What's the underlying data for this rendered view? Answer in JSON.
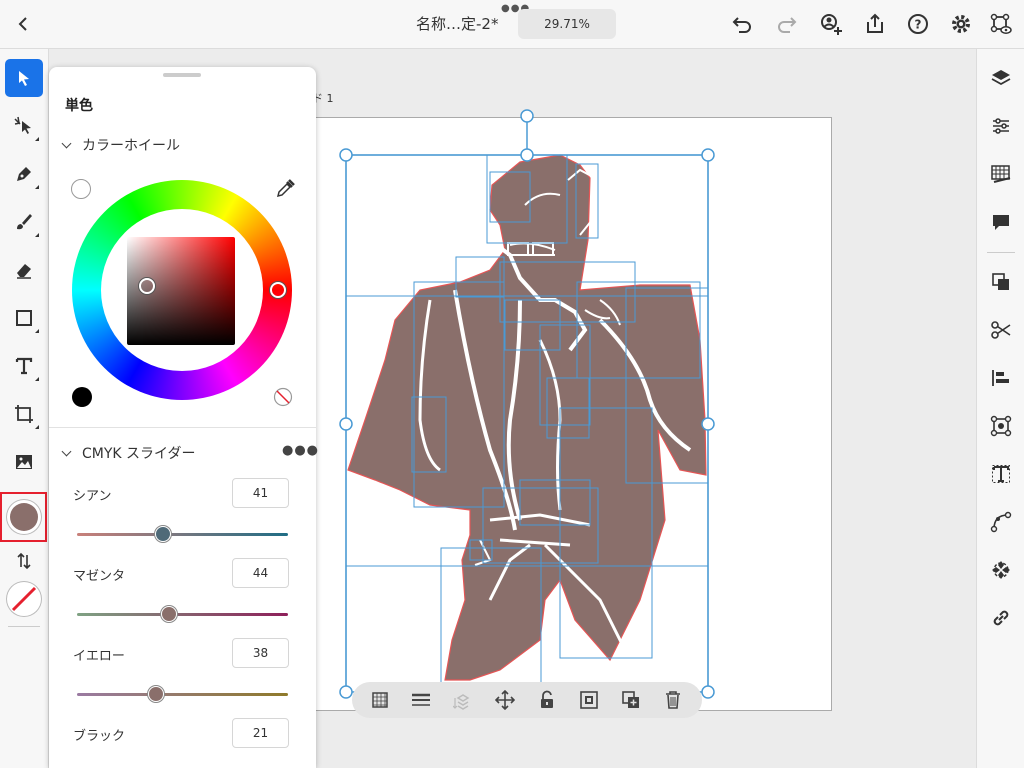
{
  "header": {
    "back_icon": "chevron-left-icon",
    "title": "名称…定-2*",
    "zoom": "29.71%",
    "actions": [
      "undo-icon",
      "redo-icon",
      "share-user-icon",
      "export-icon",
      "help-icon",
      "settings-icon",
      "preview-icon"
    ]
  },
  "canvas": {
    "artboard_label": "ド 1"
  },
  "color_panel": {
    "title": "単色",
    "wheel_section": "カラーホイール",
    "cmyk_section": "CMYK スライダー",
    "sliders": [
      {
        "label": "シアン",
        "value": "41"
      },
      {
        "label": "マゼンタ",
        "value": "44"
      },
      {
        "label": "イエロー",
        "value": "38"
      },
      {
        "label": "ブラック",
        "value": "21"
      }
    ]
  },
  "fill_color": "#8a6f6b",
  "accent_color": "#1a73e8",
  "highlight_color": "#e5202e"
}
